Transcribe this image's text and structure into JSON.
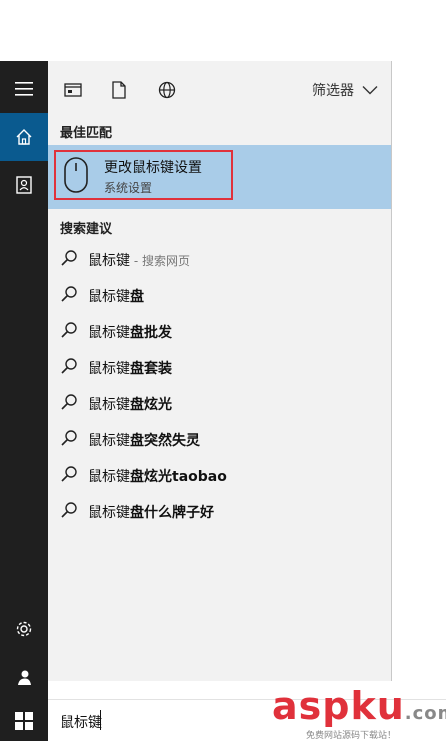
{
  "colors": {
    "taskbar_bg": "#1f1f1f",
    "active_blue": "#0a5a8f",
    "highlight": "#a9cce8",
    "outline_red": "#e0313b",
    "watermark_red": "#e0313b",
    "watermark_gray": "#888888"
  },
  "taskbar": {
    "icons": [
      "hamburger-icon",
      "home-icon",
      "contact-icon",
      "gear-icon",
      "user-icon",
      "windows-logo-icon"
    ]
  },
  "toolbar": {
    "icons": [
      "app-window-icon",
      "document-icon",
      "globe-icon"
    ],
    "filter_label": "筛选器"
  },
  "best_match": {
    "section_title": "最佳匹配",
    "title": "更改鼠标键设置",
    "subtitle": "系统设置",
    "icon": "mouse-icon"
  },
  "suggestions": {
    "section_title": "搜索建议",
    "items": [
      {
        "prefix": "鼠标键",
        "bold": "",
        "note": " - 搜索网页"
      },
      {
        "prefix": "鼠标键",
        "bold": "盘",
        "note": ""
      },
      {
        "prefix": "鼠标键",
        "bold": "盘批发",
        "note": ""
      },
      {
        "prefix": "鼠标键",
        "bold": "盘套装",
        "note": ""
      },
      {
        "prefix": "鼠标键",
        "bold": "盘炫光",
        "note": ""
      },
      {
        "prefix": "鼠标键",
        "bold": "盘突然失灵",
        "note": ""
      },
      {
        "prefix": "鼠标键",
        "bold": "盘炫光taobao",
        "note": ""
      },
      {
        "prefix": "鼠标键",
        "bold": "盘什么牌子好",
        "note": ""
      }
    ]
  },
  "search": {
    "value": "鼠标键"
  },
  "watermark": {
    "brand_part1": "asp",
    "brand_part2": "ku",
    "brand_part3": ".com",
    "tagline": "免费网站源码下载站！"
  }
}
